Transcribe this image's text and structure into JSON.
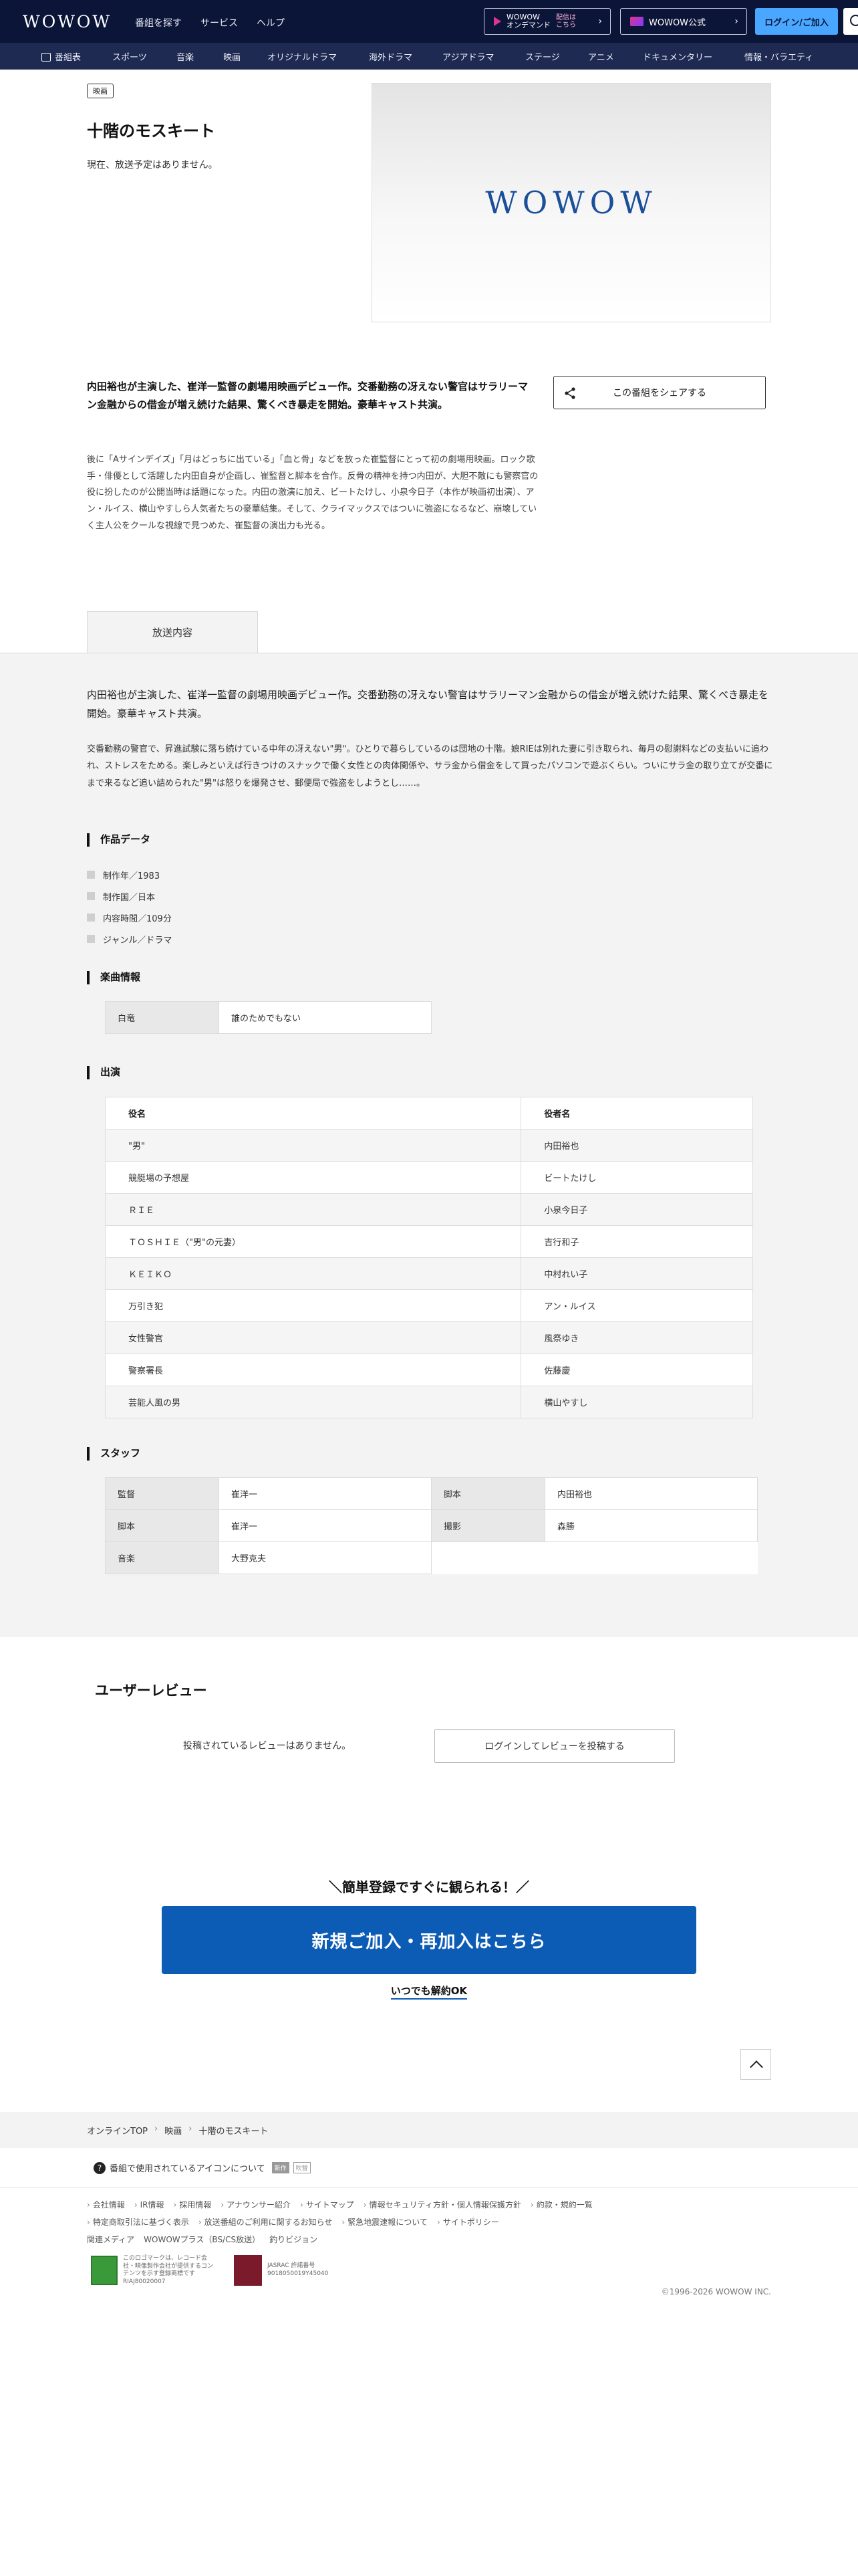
{
  "header": {
    "logo": "WOWOW",
    "nav": [
      "番組を探す",
      "サービス",
      "ヘルプ"
    ],
    "ondemand": {
      "line1": "WOWOW",
      "line2": "オンデマンド",
      "line3": "配信は",
      "line4": "こちら"
    },
    "official": "WOWOW公式",
    "login": "ログイン/ご加入"
  },
  "categories": [
    "番組表",
    "スポーツ",
    "音楽",
    "映画",
    "オリジナルドラマ",
    "海外ドラマ",
    "アジアドラマ",
    "ステージ",
    "アニメ",
    "ドキュメンタリー",
    "情報・バラエティ"
  ],
  "program": {
    "genre_badge": "映画",
    "title": "十階のモスキート",
    "schedule": "現在、放送予定はありません。",
    "image_logo": "WOWOW",
    "lead": "内田裕也が主演した、崔洋一監督の劇場用映画デビュー作。交番勤務の冴えない警官はサラリーマン金融からの借金が増え続けた結果、驚くべき暴走を開始。豪華キャスト共演。",
    "description": "後に「Aサインデイズ」「月はどっちに出ている」「血と骨」などを放った崔監督にとって初の劇場用映画。ロック歌手・俳優として活躍した内田自身が企画し、崔監督と脚本を合作。反骨の精神を持つ内田が、大胆不敵にも警察官の役に扮したのが公開当時は話題になった。内田の激演に加え、ビートたけし、小泉今日子（本作が映画初出演）、アン・ルイス、横山やすしら人気者たちの豪華結集。そして、クライマックスではついに強盗になるなど、崩壊していく主人公をクールな視線で見つめた、崔監督の演出力も光る。",
    "share_label": "この番組をシェアする"
  },
  "tabs": {
    "broadcast": "放送内容"
  },
  "broadcast": {
    "lead": "内田裕也が主演した、崔洋一監督の劇場用映画デビュー作。交番勤務の冴えない警官はサラリーマン金融からの借金が増え続けた結果、驚くべき暴走を開始。豪華キャスト共演。",
    "story": "交番勤務の警官で、昇進試験に落ち続けている中年の冴えない\"男\"。ひとりで暮らしているのは団地の十階。娘RIEは別れた妻に引き取られ、毎月の慰謝料などの支払いに追われ、ストレスをためる。楽しみといえば行きつけのスナックで働く女性との肉体関係や、サラ金から借金をして買ったパソコンで遊ぶくらい。ついにサラ金の取り立てが交番にまで来るなど追い詰められた\"男\"は怒りを爆発させ、郵便局で強盗をしようとし……。"
  },
  "sections": {
    "spec": "作品データ",
    "music": "楽曲情報",
    "cast": "出演",
    "staff": "スタッフ"
  },
  "spec_items": [
    "制作年／1983",
    "制作国／日本",
    "内容時間／109分",
    "ジャンル／ドラマ"
  ],
  "music": {
    "artist": "白竜",
    "song": "誰のためでもない"
  },
  "cast": {
    "header_role": "役名",
    "header_actor": "役者名",
    "rows": [
      {
        "role": "\"男\"",
        "actor": "内田裕也"
      },
      {
        "role": "競艇場の予想屋",
        "actor": "ビートたけし"
      },
      {
        "role": "ＲＩＥ",
        "actor": "小泉今日子"
      },
      {
        "role": "ＴＯＳＨＩＥ（\"男\"の元妻）",
        "actor": "吉行和子"
      },
      {
        "role": "ＫＥＩＫＯ",
        "actor": "中村れい子"
      },
      {
        "role": "万引き犯",
        "actor": "アン・ルイス"
      },
      {
        "role": "女性警官",
        "actor": "風祭ゆき"
      },
      {
        "role": "警察署長",
        "actor": "佐藤慶"
      },
      {
        "role": "芸能人風の男",
        "actor": "横山やすし"
      }
    ]
  },
  "staff": [
    {
      "k": "監督",
      "v": "崔洋一"
    },
    {
      "k": "脚本",
      "v": "内田裕也"
    },
    {
      "k": "脚本",
      "v": "崔洋一"
    },
    {
      "k": "撮影",
      "v": "森勝"
    },
    {
      "k": "音楽",
      "v": "大野克夫"
    }
  ],
  "reviews": {
    "title": "ユーザーレビュー",
    "empty": "投稿されているレビューはありません。",
    "login_button": "ログインしてレビューを投稿する"
  },
  "cta": {
    "catch": "＼簡単登録ですぐに観られる！／",
    "button": "新規ご加入・再加入はこちら",
    "sub": "いつでも解約OK"
  },
  "breadcrumb": [
    "オンラインTOP",
    "映画",
    "十階のモスキート"
  ],
  "icon_help": {
    "text": "番組で使用されているアイコンについて",
    "sample1": "新作",
    "sample2": "吹替"
  },
  "footer": {
    "links_row1": [
      "会社情報",
      "IR情報",
      "採用情報",
      "アナウンサー紹介",
      "サイトマップ",
      "情報セキュリティ方針・個人情報保護方針",
      "約款・規約一覧"
    ],
    "links_row2": [
      "特定商取引法に基づく表示",
      "放送番組のご利用に関するお知らせ",
      "緊急地震速報について",
      "サイトポリシー"
    ],
    "related_label": "関連メディア",
    "related": [
      "WOWOWプラス（BS/CS放送）",
      "釣りビジョン"
    ],
    "mark1_text": "このロゴマークは、レコード会社・映像製作会社が提供するコンテンツを示す登録商標です RIAJ80020007",
    "mark2_text": "JASRAC 許諾番号 9018050019Y45040",
    "copyright": "©1996-2026 WOWOW INC."
  }
}
